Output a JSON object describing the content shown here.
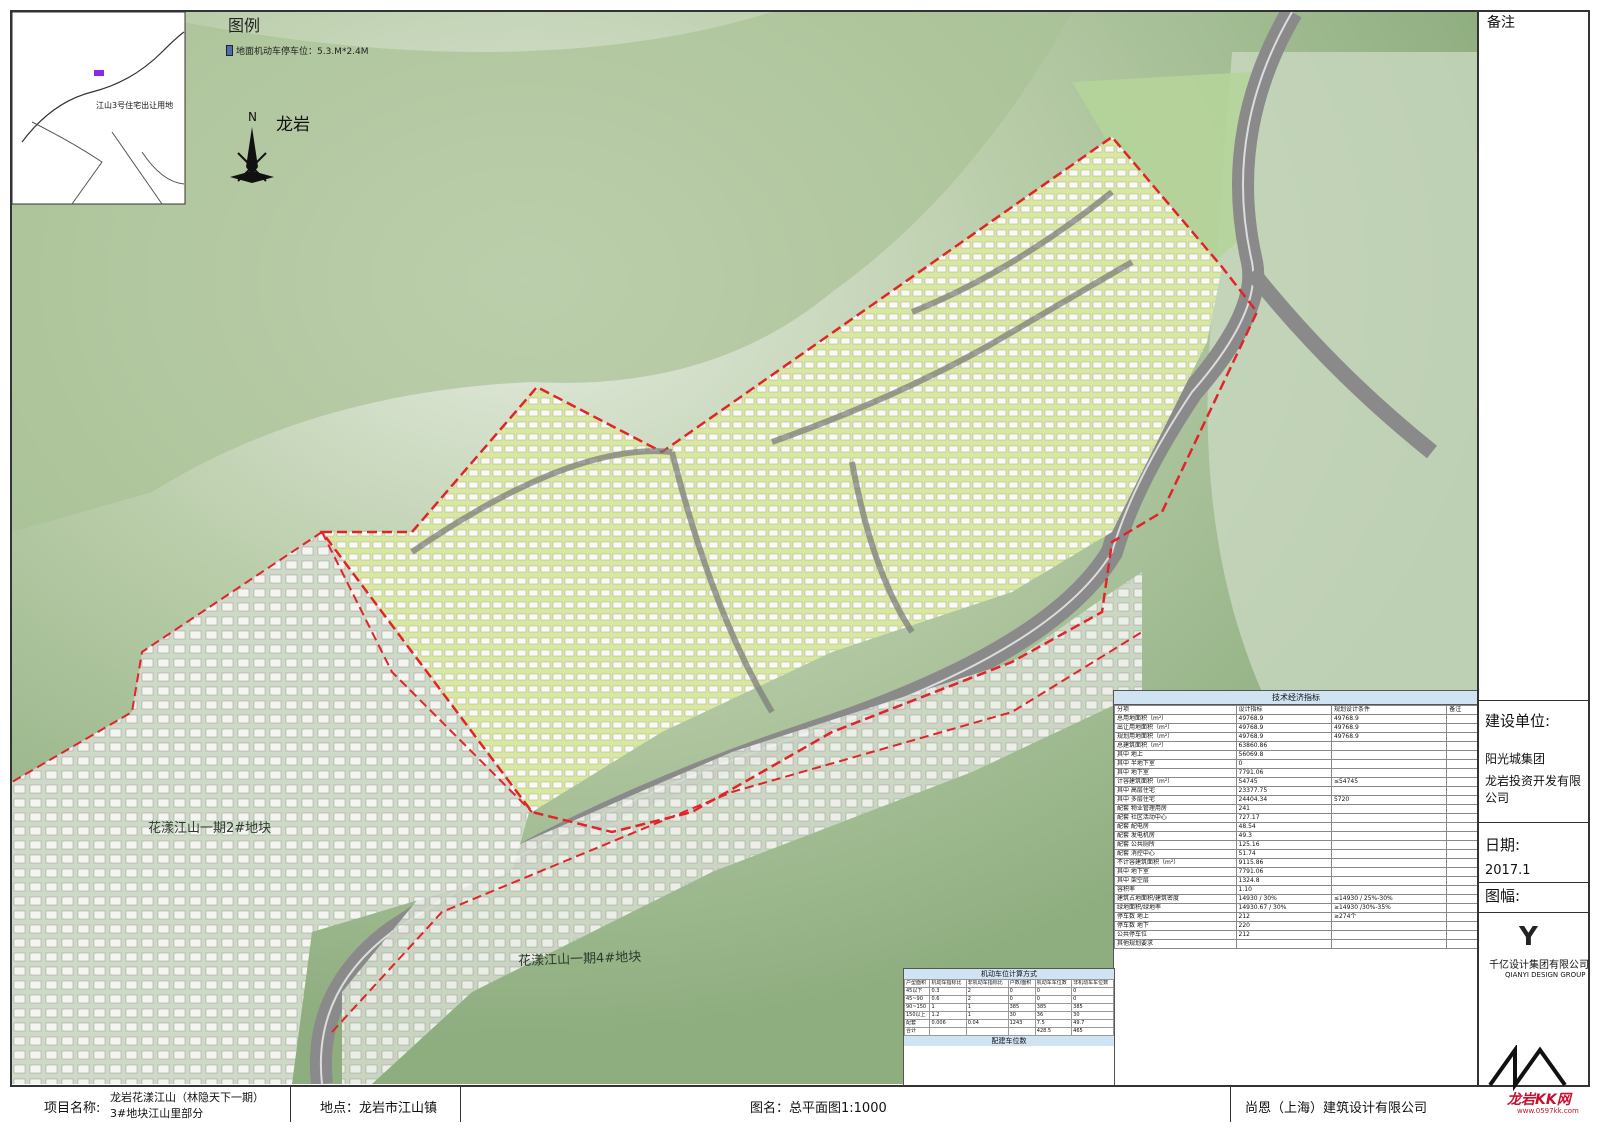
{
  "legend": {
    "title": "图例",
    "item": "地面机动车停车位：5.3.M*2.4M"
  },
  "compass": {
    "n": "N",
    "city": "龙岩"
  },
  "location_map": {
    "label": "江山3号住宅出让用地"
  },
  "map_labels": {
    "phase1_2": "花漾江山一期2#地块",
    "phase1_4": "花漾江山一期4#地块"
  },
  "notes": {
    "title": "备注"
  },
  "client": {
    "label": "建设单位:",
    "line1": "阳光城集团",
    "line2": "龙岩投资开发有限公司"
  },
  "date": {
    "label": "日期:",
    "value": "2017.1"
  },
  "size": {
    "label": "图幅:"
  },
  "designer": {
    "logo": "Y",
    "name": "千亿设计集团有限公司",
    "name_en": "QIANYI DESIGN GROUP"
  },
  "titleblock": {
    "project_label": "项目名称:",
    "project_line1": "龙岩花漾江山（林隐天下一期）",
    "project_line2": "3#地块江山里部分",
    "location": "地点：龙岩市江山镇",
    "drawing": "图名：总平面图1:1000",
    "firm": "尚恩（上海）建筑设计有限公司"
  },
  "tech_table": {
    "title": "技术经济指标",
    "headers": [
      "分项",
      "设计指标",
      "规划设计条件",
      "备注"
    ],
    "rows": [
      [
        "总用地面积（m²）",
        "49768.9",
        "49768.9",
        ""
      ],
      [
        "出让用地面积（m²）",
        "49768.9",
        "49768.9",
        ""
      ],
      [
        "规划用地面积（m²）",
        "49768.9",
        "49768.9",
        ""
      ],
      [
        "总建筑面积（m²）",
        "63860.86",
        "",
        ""
      ],
      [
        "其中 地上",
        "56069.8",
        "",
        ""
      ],
      [
        "其中 半地下室",
        "0",
        "",
        ""
      ],
      [
        "其中 地下室",
        "7791.06",
        "",
        ""
      ],
      [
        "计容建筑面积（m²）",
        "54745",
        "≤54745",
        ""
      ],
      [
        "其中 高层住宅",
        "23377.75",
        "",
        ""
      ],
      [
        "其中 多层住宅",
        "24404.34",
        "5720",
        ""
      ],
      [
        "配套 物业管理用房",
        "241",
        "",
        ""
      ],
      [
        "配套 社区活动中心",
        "727.17",
        "",
        ""
      ],
      [
        "配套 配电房",
        "48.54",
        "",
        ""
      ],
      [
        "配套 发电机房",
        "49.3",
        "",
        ""
      ],
      [
        "配套 公共厕所",
        "125.16",
        "",
        ""
      ],
      [
        "配套 消控中心",
        "51.74",
        "",
        ""
      ],
      [
        "不计容建筑面积（m²）",
        "9115.86",
        "",
        ""
      ],
      [
        "其中 地下室",
        "7791.06",
        "",
        ""
      ],
      [
        "其中 架空层",
        "1324.8",
        "",
        ""
      ],
      [
        "容积率",
        "1.10",
        "",
        ""
      ],
      [
        "建筑占地面积/建筑密度",
        "14930 / 30%",
        "≤14930 / 25%-30%",
        ""
      ],
      [
        "绿地面积/绿地率",
        "14930.67 / 30%",
        "≥14930 /30%-35%",
        ""
      ],
      [
        "停车数 地上",
        "212",
        "≥274个",
        ""
      ],
      [
        "停车数 地下",
        "220",
        "",
        ""
      ],
      [
        "公共停车位",
        "212",
        "",
        ""
      ],
      [
        "其他规划要求",
        "",
        "",
        ""
      ]
    ]
  },
  "parking_table": {
    "title": "机动车位计算方式",
    "headers": [
      "户型面积",
      "机动车指标比",
      "非机动车指标比",
      "户数/面积",
      "机动车车位数",
      "非机动车车位数"
    ],
    "rows": [
      [
        "45以下",
        "0.3",
        "2",
        "0",
        "0",
        "0"
      ],
      [
        "45~90",
        "0.6",
        "2",
        "0",
        "0",
        "0"
      ],
      [
        "90~150",
        "1",
        "1",
        "385",
        "385",
        "385"
      ],
      [
        "150以上",
        "1.2",
        "1",
        "30",
        "36",
        "30"
      ],
      [
        "配套",
        "0.006",
        "0.04",
        "1243",
        "7.5",
        "49.7"
      ],
      [
        "合计",
        "",
        "",
        "",
        "428.5",
        "465"
      ]
    ],
    "subtitle": "配建车位数"
  },
  "watermark": {
    "text": "龙岩KK网",
    "url": "www.0597kk.com"
  },
  "colors": {
    "terrain": "#9cb88a",
    "boundary": "#e0242a",
    "road": "#7a7a7a",
    "site": "#d9e8a0",
    "table_head": "#cfe3f3"
  }
}
